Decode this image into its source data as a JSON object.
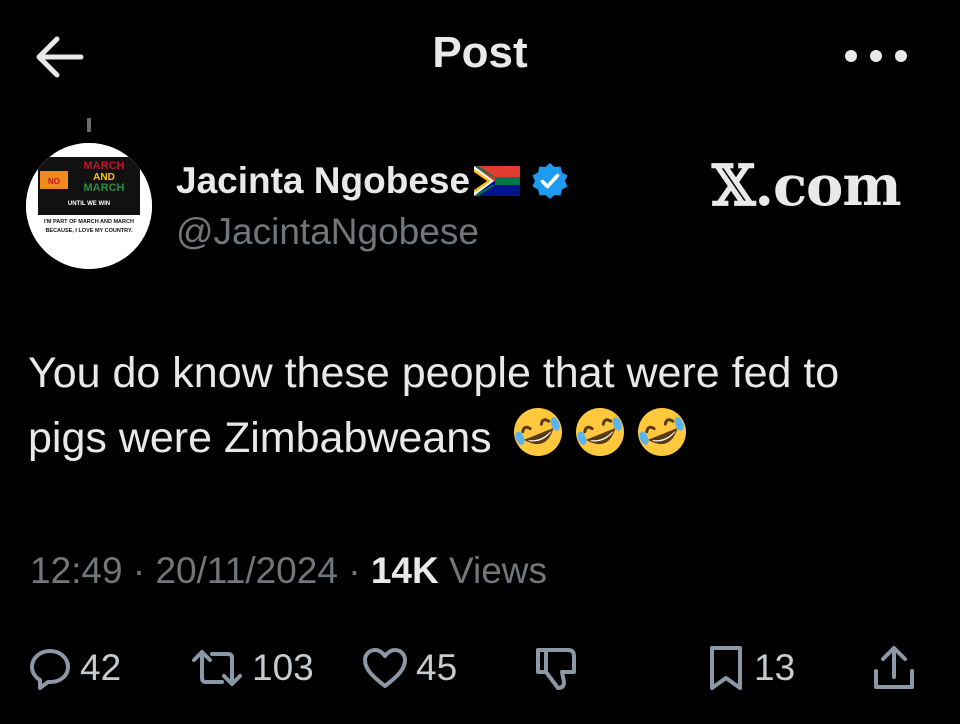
{
  "header": {
    "title": "Post",
    "back_icon": "arrow-left-icon",
    "more_icon": "more-horizontal-icon"
  },
  "author": {
    "name": "Jacinta Ngobese",
    "handle": "@JacintaNgobese",
    "verified": true,
    "verified_color": "#1d9bf0",
    "flag_icon": "south-africa-flag-icon",
    "avatar": {
      "line1": "MARCH",
      "line2": "AND",
      "line3": "MARCH",
      "line4": "UNTIL WE WIN",
      "caption1": "I'M PART OF MARCH AND MARCH",
      "caption2": "BECAUSE, I LOVE MY COUNTRY."
    }
  },
  "watermark": "𝕏.com",
  "post": {
    "text": "You do know these people that were fed to pigs were Zimbabweans",
    "emoji": [
      "rolling-on-floor-laughing-emoji",
      "rolling-on-floor-laughing-emoji",
      "rolling-on-floor-laughing-emoji"
    ]
  },
  "meta": {
    "time": "12:49",
    "separator": "·",
    "date": "20/11/2024",
    "views_count": "14K",
    "views_label": "Views"
  },
  "actions": {
    "reply_count": "42",
    "repost_count": "103",
    "like_count": "45",
    "bookmark_count": "13"
  },
  "colors": {
    "background": "#000000",
    "primary_text": "#e7e9ea",
    "secondary_text": "#71767b",
    "accent": "#1d9bf0"
  }
}
